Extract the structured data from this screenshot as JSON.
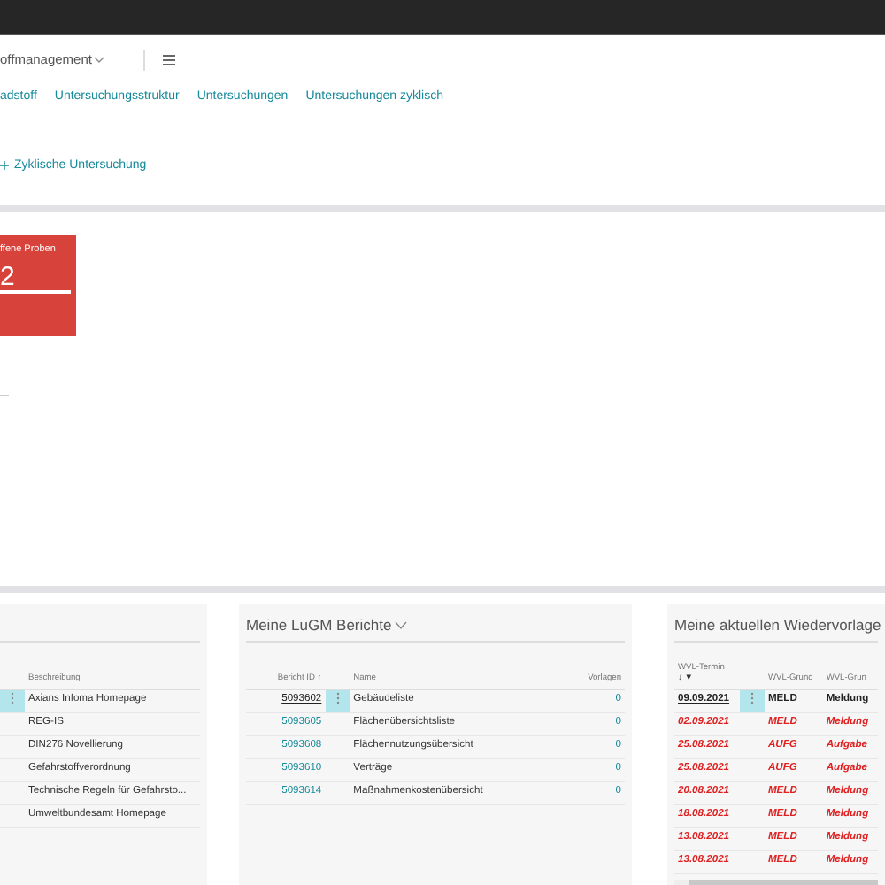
{
  "header": {
    "app_title": "offmanagement",
    "nav": [
      {
        "label": "adstoff"
      },
      {
        "label": "Untersuchungsstruktur"
      },
      {
        "label": "Untersuchungen"
      },
      {
        "label": "Untersuchungen zyklisch"
      }
    ],
    "action": "Zyklische Untersuchung"
  },
  "tile": {
    "label": "ffene Proben",
    "value": "2"
  },
  "cards": [
    {
      "columns": [
        {
          "label": "Beschreibung"
        }
      ],
      "rows": [
        {
          "selected": true,
          "overdue": false,
          "cells": [
            "Axians Infoma Homepage"
          ]
        },
        {
          "selected": false,
          "overdue": false,
          "cells": [
            "REG-IS"
          ]
        },
        {
          "selected": false,
          "overdue": false,
          "cells": [
            "DIN276 Novellierung"
          ]
        },
        {
          "selected": false,
          "overdue": false,
          "cells": [
            "Gefahrstoffverordnung"
          ]
        },
        {
          "selected": false,
          "overdue": false,
          "cells": [
            "Technische Regeln für Gefahrsto..."
          ]
        },
        {
          "selected": false,
          "overdue": false,
          "cells": [
            "Umweltbundesamt Homepage"
          ]
        }
      ]
    },
    {
      "title": "Meine LuGM Berichte",
      "columns": [
        {
          "label": "Bericht ID ↑",
          "kind": "link"
        },
        {
          "label": "Name",
          "kind": "text"
        },
        {
          "label": "Vorlagen",
          "kind": "link"
        }
      ],
      "rows": [
        {
          "selected": true,
          "overdue": false,
          "cells": [
            "5093602",
            "Gebäudeliste",
            "0"
          ]
        },
        {
          "selected": false,
          "overdue": false,
          "cells": [
            "5093605",
            "Flächenübersichtsliste",
            "0"
          ]
        },
        {
          "selected": false,
          "overdue": false,
          "cells": [
            "5093608",
            "Flächennutzungsübersicht",
            "0"
          ]
        },
        {
          "selected": false,
          "overdue": false,
          "cells": [
            "5093610",
            "Verträge",
            "0"
          ]
        },
        {
          "selected": false,
          "overdue": false,
          "cells": [
            "5093614",
            "Maßnahmenkostenübersicht",
            "0"
          ]
        }
      ]
    },
    {
      "title": "Meine aktuellen Wiedervorlage",
      "columns": [
        {
          "label": "WVL-Termin",
          "sort": "↓ ▼"
        },
        {
          "label": "WVL-Grund"
        },
        {
          "label": "WVL-Grun"
        }
      ],
      "rows": [
        {
          "selected": true,
          "overdue": false,
          "cells": [
            "09.09.2021",
            "MELD",
            "Meldung"
          ]
        },
        {
          "selected": false,
          "overdue": true,
          "cells": [
            "02.09.2021",
            "MELD",
            "Meldung"
          ]
        },
        {
          "selected": false,
          "overdue": true,
          "cells": [
            "25.08.2021",
            "AUFG",
            "Aufgabe"
          ]
        },
        {
          "selected": false,
          "overdue": true,
          "cells": [
            "25.08.2021",
            "AUFG",
            "Aufgabe"
          ]
        },
        {
          "selected": false,
          "overdue": true,
          "cells": [
            "20.08.2021",
            "MELD",
            "Meldung"
          ]
        },
        {
          "selected": false,
          "overdue": true,
          "cells": [
            "18.08.2021",
            "MELD",
            "Meldung"
          ]
        },
        {
          "selected": false,
          "overdue": true,
          "cells": [
            "13.08.2021",
            "MELD",
            "Meldung"
          ]
        },
        {
          "selected": false,
          "overdue": true,
          "cells": [
            "13.08.2021",
            "MELD",
            "Meldung"
          ]
        }
      ]
    }
  ]
}
